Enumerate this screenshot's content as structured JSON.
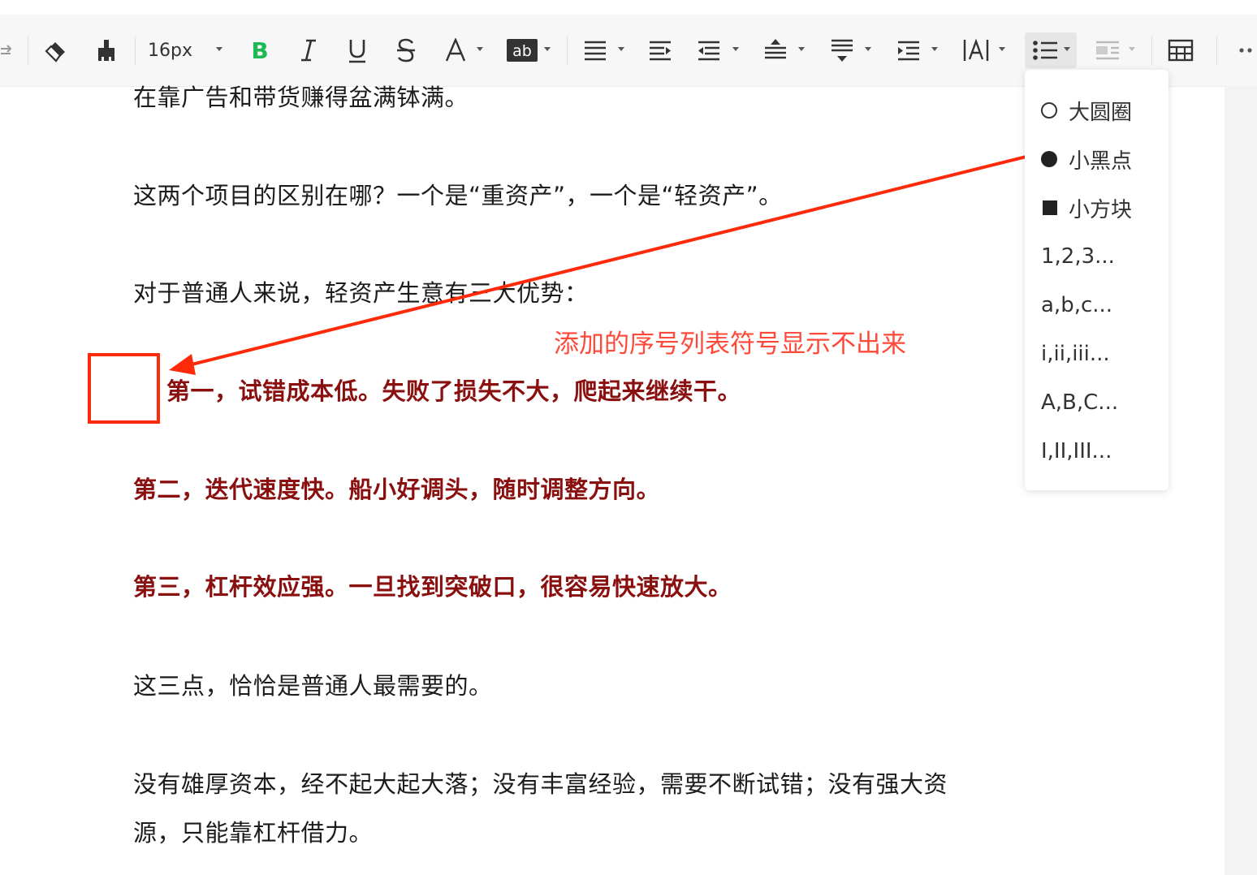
{
  "toolbar": {
    "font_size": "16px",
    "bold_label": "B"
  },
  "document": {
    "paragraphs": [
      "在靠广告和带货赚得盆满钵满。",
      "这两个项目的区别在哪？一个是“重资产”，一个是“轻资产”。",
      "对于普通人来说，轻资产生意有三大优势：",
      "第一，试错成本低。失败了损失不大，爬起来继续干。",
      "第二，迭代速度快。船小好调头，随时调整方向。",
      "第三，杠杆效应强。一旦找到突破口，很容易快速放大。",
      "这三点，恰恰是普通人最需要的。",
      "没有雄厚资本，经不起大起大落；没有丰富经验，需要不断试错；没有强大资",
      "源，只能靠杠杆借力。"
    ]
  },
  "annotation": {
    "text": "添加的序号列表符号显示不出来"
  },
  "list_dropdown": {
    "items": [
      {
        "label": "大圆圈",
        "marker": "circle-icon"
      },
      {
        "label": "小黑点",
        "marker": "dot-icon"
      },
      {
        "label": "小方块",
        "marker": "square-icon"
      },
      {
        "label": "1,2,3..."
      },
      {
        "label": "a,b,c..."
      },
      {
        "label": "i,ii,iii..."
      },
      {
        "label": "A,B,C..."
      },
      {
        "label": "I,II,III..."
      }
    ]
  },
  "colors": {
    "emphasis_text": "#8a1010",
    "annotation": "#ff2a0a",
    "bold_button": "#1db954"
  }
}
